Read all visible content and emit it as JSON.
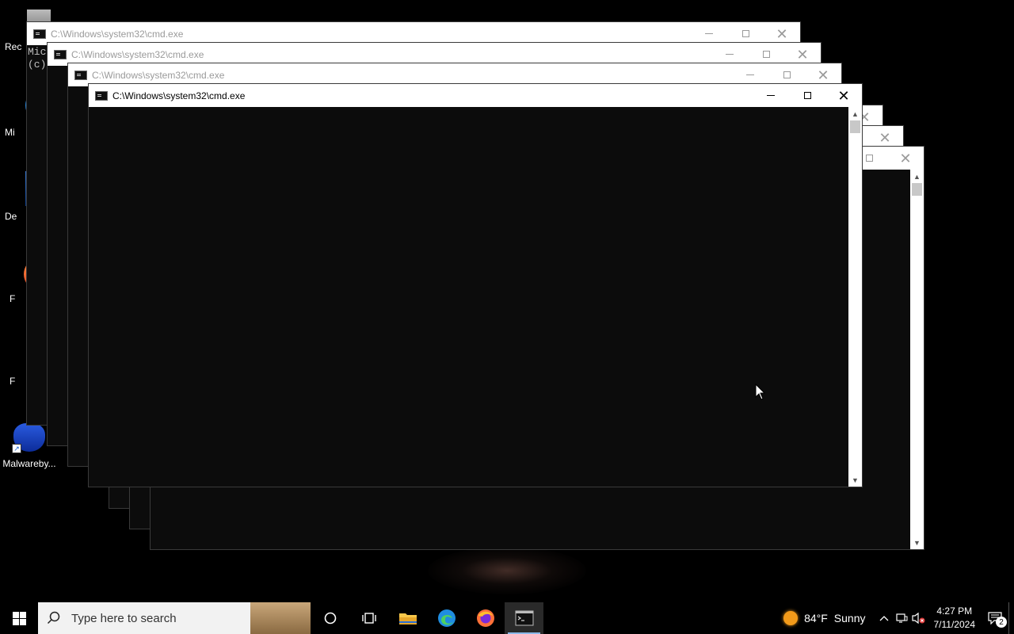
{
  "desktop": {
    "icons": [
      {
        "label": "Rec"
      },
      {
        "label": "Mi"
      },
      {
        "label": "De"
      },
      {
        "label": "F"
      },
      {
        "label": "F"
      },
      {
        "label": "Malwareby..."
      }
    ]
  },
  "windows": {
    "title": "C:\\Windows\\system32\\cmd.exe",
    "console_lines": [
      "Mic",
      "(c)"
    ]
  },
  "taskbar": {
    "search_placeholder": "Type here to search",
    "weather_temp": "84°F",
    "weather_desc": "Sunny",
    "time": "4:27 PM",
    "date": "7/11/2024",
    "notification_count": "2"
  },
  "colors": {
    "console_bg": "#0c0c0c",
    "titlebar_bg": "#ffffff",
    "taskbar_bg": "#000000",
    "active_indicator": "#8cb8e8"
  }
}
